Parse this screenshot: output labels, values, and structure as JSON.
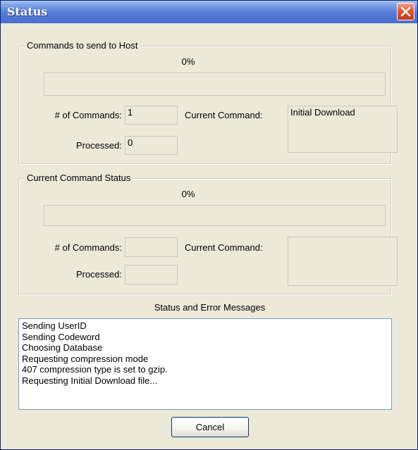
{
  "window": {
    "title": "Status"
  },
  "host_group": {
    "title": "Commands to send to Host",
    "percent_text": "0%",
    "progress": 0,
    "num_commands_label": "# of Commands:",
    "num_commands_value": "1",
    "processed_label": "Processed:",
    "processed_value": "0",
    "current_command_label": "Current Command:",
    "current_command_value": "Initial Download"
  },
  "status_group": {
    "title": "Current Command Status",
    "percent_text": "0%",
    "progress": 0,
    "num_commands_label": "# of Commands:",
    "num_commands_value": "",
    "processed_label": "Processed:",
    "processed_value": "",
    "current_command_label": "Current Command:",
    "current_command_value": ""
  },
  "messages": {
    "title": "Status and Error Messages",
    "lines": [
      "Sending UserID",
      "Sending Codeword",
      "Choosing Database",
      "Requesting compression mode",
      "407 compression type is set to gzip.",
      "Requesting Initial Download file..."
    ]
  },
  "buttons": {
    "cancel_label": "Cancel"
  },
  "icons": {
    "close": "close-icon"
  },
  "colors": {
    "title_bar": "#5479d4",
    "close_button": "#e0583a",
    "dialog_bg": "#ece9d8"
  }
}
